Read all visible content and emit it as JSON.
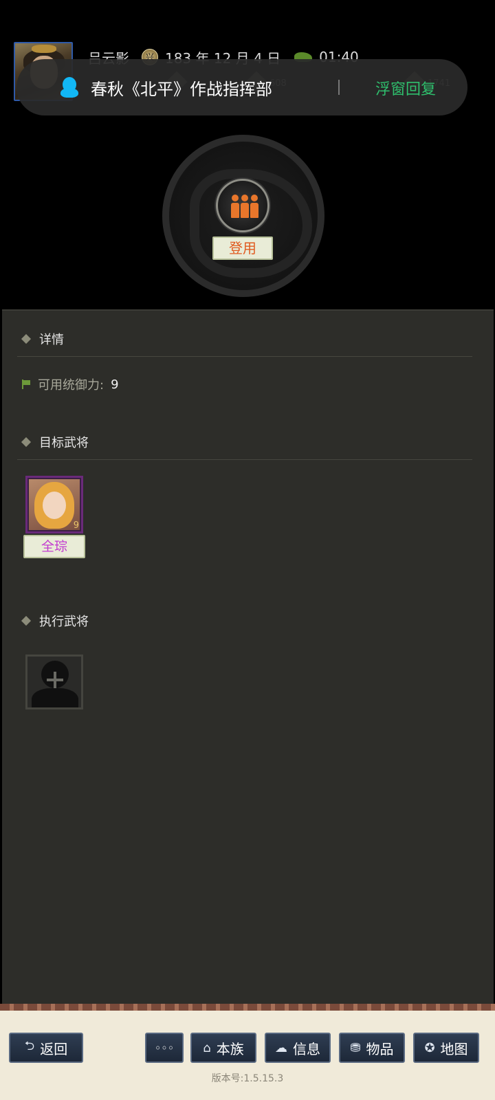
{
  "header": {
    "player_name": "吕云影",
    "era_icon": "era-emblem-icon",
    "date": "183 年 12 月 4 日",
    "horse_icon": "horse-icon",
    "time": "01:40",
    "resource_left": "608",
    "resource_right": "1741"
  },
  "notification": {
    "icon": "qq-icon",
    "title": "春秋《北平》作战指挥部",
    "action": "浮窗回复"
  },
  "command": {
    "icon": "people-icon",
    "label": "登用"
  },
  "details": {
    "title": "详情",
    "command_label": "可用统御力:",
    "command_value": "9"
  },
  "target": {
    "title": "目标武将",
    "general_name": "全琮",
    "general_level": "9"
  },
  "executor": {
    "title": "执行武将"
  },
  "nav": {
    "back": "返回",
    "more": "◦◦◦",
    "clan": "本族",
    "info": "信息",
    "items": "物品",
    "map": "地图"
  },
  "version": "版本号:1.5.15.3",
  "colors": {
    "accent_green": "#2fbf6d",
    "action_orange": "#e05a1f",
    "general_purple": "#c23ad0",
    "panel_bg": "#2d2d29"
  }
}
